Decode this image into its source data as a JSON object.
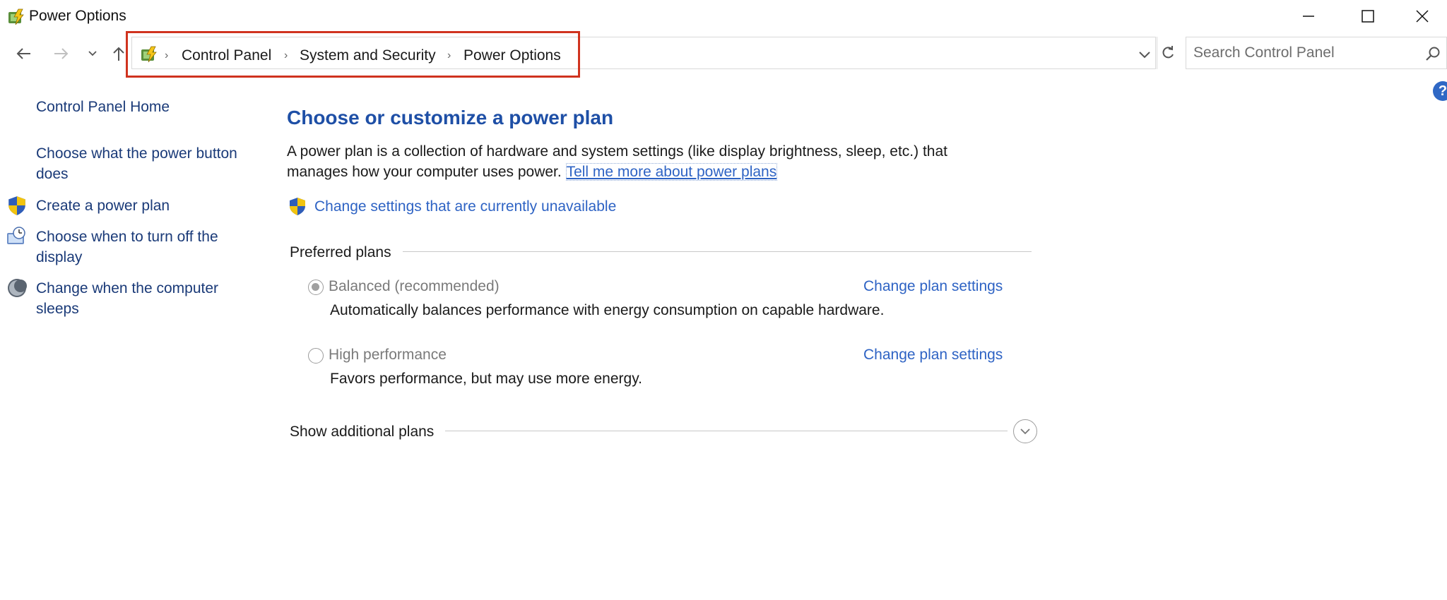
{
  "window": {
    "title": "Power Options"
  },
  "address": {
    "crumbs": [
      "Control Panel",
      "System and Security",
      "Power Options"
    ]
  },
  "search": {
    "placeholder": "Search Control Panel"
  },
  "help": {
    "label": "?"
  },
  "sidebar": {
    "home": "Control Panel Home",
    "items": [
      {
        "label": "Choose what the power button does",
        "icon": "none"
      },
      {
        "label": "Create a power plan",
        "icon": "shield-icon"
      },
      {
        "label": "Choose when to turn off the display",
        "icon": "monitor-clock-icon"
      },
      {
        "label": "Change when the computer sleeps",
        "icon": "moon-icon"
      }
    ]
  },
  "main": {
    "heading": "Choose or customize a power plan",
    "description": "A power plan is a collection of hardware and system settings (like display brightness, sleep, etc.) that manages how your computer uses power.",
    "more_link": "Tell me more about power plans",
    "change_settings": "Change settings that are currently unavailable",
    "preferred_label": "Preferred plans",
    "plans": [
      {
        "name": "Balanced (recommended)",
        "selected": true,
        "description": "Automatically balances performance with energy consumption on capable hardware.",
        "link": "Change plan settings"
      },
      {
        "name": "High performance",
        "selected": false,
        "description": "Favors performance, but may use more energy.",
        "link": "Change plan settings"
      }
    ],
    "additional_label": "Show additional plans"
  },
  "colors": {
    "link": "#2e63c4",
    "heading": "#1e4fa6",
    "highlight": "#d0331f"
  }
}
